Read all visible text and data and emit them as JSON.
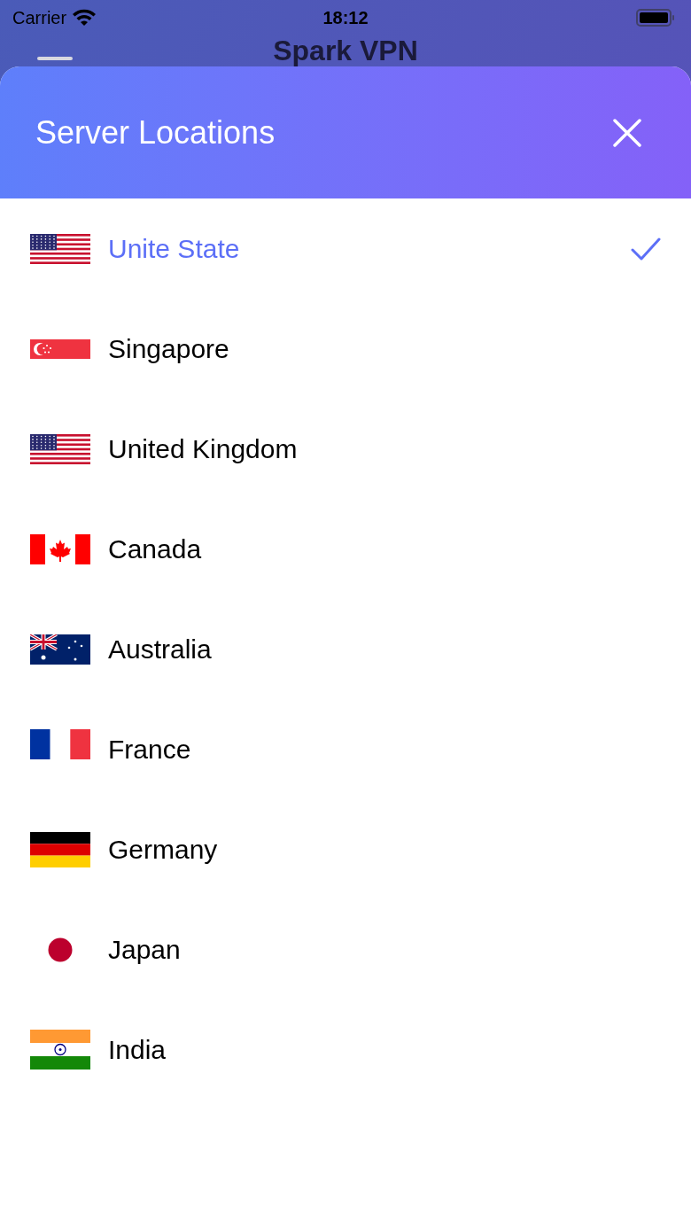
{
  "status_bar": {
    "carrier": "Carrier",
    "time": "18:12"
  },
  "app_bar": {
    "title": "Spark VPN"
  },
  "sheet": {
    "title": "Server Locations"
  },
  "locations": [
    {
      "name": "Unite State",
      "kind": "us",
      "selected": true
    },
    {
      "name": "Singapore",
      "kind": "sg",
      "selected": false
    },
    {
      "name": "United Kingdom",
      "kind": "us",
      "selected": false
    },
    {
      "name": "Canada",
      "kind": "ca",
      "selected": false
    },
    {
      "name": "Australia",
      "kind": "au",
      "selected": false
    },
    {
      "name": "France",
      "kind": "fr",
      "selected": false
    },
    {
      "name": "Germany",
      "kind": "de",
      "selected": false
    },
    {
      "name": "Japan",
      "kind": "jp",
      "selected": false
    },
    {
      "name": "India",
      "kind": "in",
      "selected": false
    }
  ]
}
